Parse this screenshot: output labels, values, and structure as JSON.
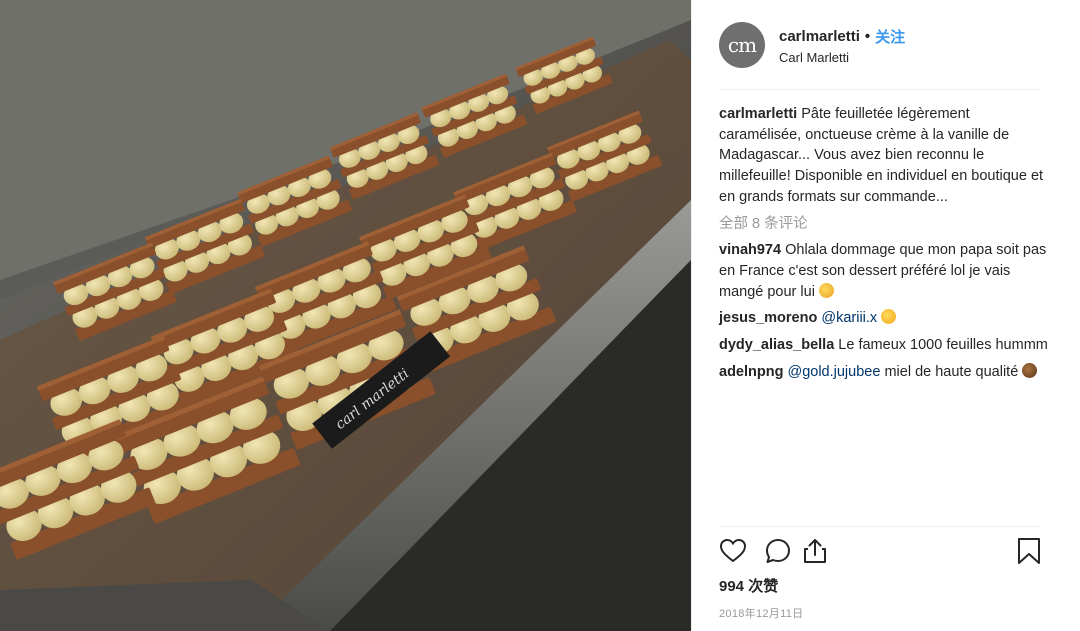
{
  "header": {
    "avatar_text": "cm",
    "username": "carlmarletti",
    "separator": "•",
    "follow_label": "关注",
    "full_name": "Carl Marletti"
  },
  "caption": {
    "username": "carlmarletti",
    "text": "Pâte feuilletée légèrement caramélisée, onctueuse crème à la vanille de Madagascar... Vous avez bien reconnu le millefeuille! Disponible en individuel en boutique et en grands formats sur commande..."
  },
  "view_all_comments": "全部 8 条评论",
  "comments": [
    {
      "username": "vinah974",
      "text": "Ohlala dommage que mon papa soit pas en France c'est son dessert préféré lol je vais mangé pour lui",
      "mention": "",
      "emoji": "party-emoji"
    },
    {
      "username": "jesus_moreno",
      "text": "",
      "mention": "@kariii.x",
      "emoji": "heart-eyes-emoji"
    },
    {
      "username": "dydy_alias_bella",
      "text": "Le fameux 1000 feuilles hummm",
      "mention": "",
      "emoji": ""
    },
    {
      "username": "adelnpng",
      "text": "miel de haute qualité",
      "mention": "@gold.jujubee",
      "emoji": "honey-pot-emoji"
    }
  ],
  "actions": {
    "like_icon": "heart-icon",
    "comment_icon": "comment-icon",
    "share_icon": "share-icon",
    "save_icon": "bookmark-icon"
  },
  "likes_text": "994 次赞",
  "date_text": "2018年12月11日",
  "photo": {
    "label_text": "carl marletti",
    "colors": {
      "pastry": "#8a4f2b",
      "cream": "#e3d496",
      "tray": "#55544f"
    }
  },
  "colors": {
    "link": "#3897f0",
    "mention": "#003569",
    "muted": "#999999"
  }
}
